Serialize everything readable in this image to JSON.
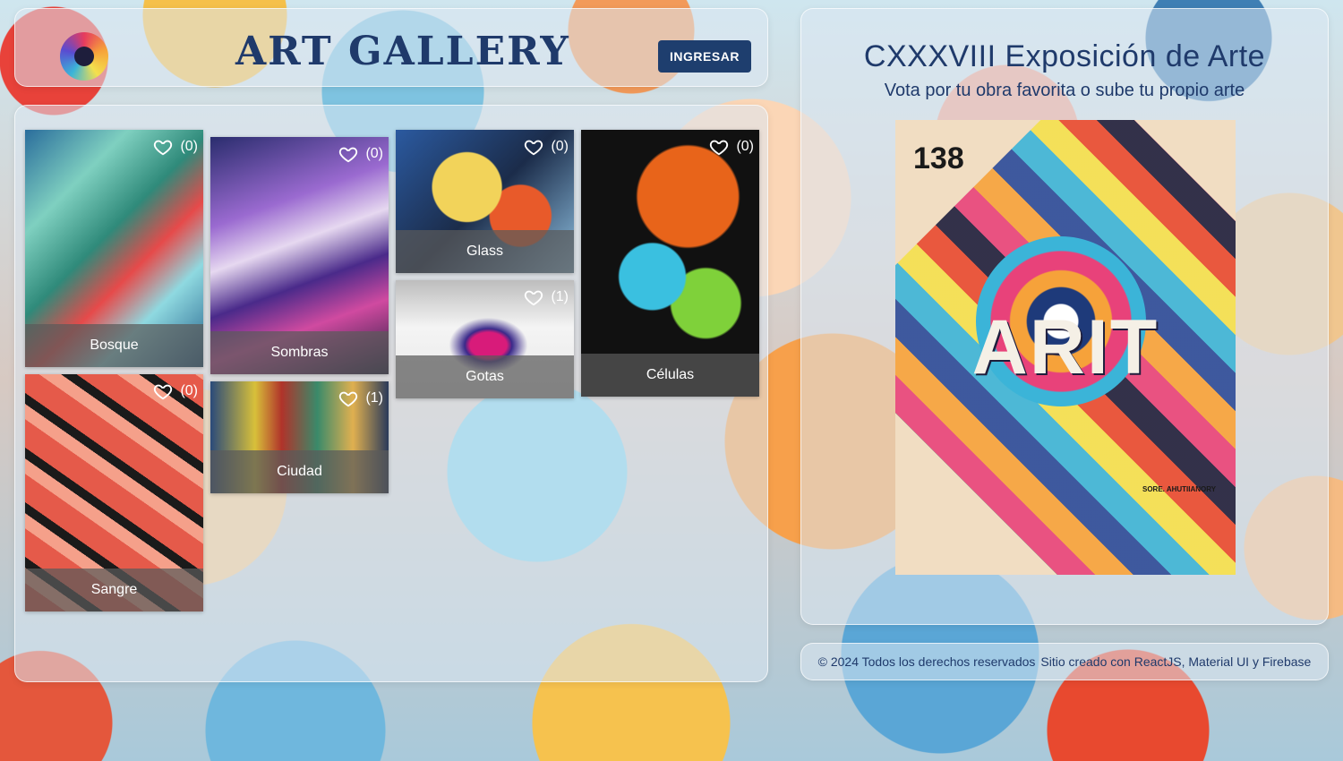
{
  "header": {
    "title": "ART GALLERY",
    "login_label": "INGRESAR"
  },
  "gallery": {
    "items": [
      {
        "title": "Bosque",
        "likes": "(0)"
      },
      {
        "title": "Sombras",
        "likes": "(0)"
      },
      {
        "title": "Glass",
        "likes": "(0)"
      },
      {
        "title": "Células",
        "likes": "(0)"
      },
      {
        "title": "Gotas",
        "likes": "(1)"
      },
      {
        "title": "Sangre",
        "likes": "(0)"
      },
      {
        "title": "Ciudad",
        "likes": "(1)"
      }
    ]
  },
  "info": {
    "title": "CXXXVIII Exposición de Arte",
    "subtitle": "Vota por tu obra favorita o sube tu propio arte",
    "poster": {
      "number": "138",
      "word": "ARIT",
      "footer_text": "SORE. AHUTIIANORY"
    }
  },
  "footer": {
    "copyright": "© 2024 Todos los derechos reservados",
    "credits": "Sitio creado con ReactJS, Material UI y Firebase"
  },
  "colors": {
    "primary": "#1f3a6b",
    "button": "#1e3e6e"
  },
  "icons": {
    "favorite": "heart-outline-icon",
    "logo": "colorful-swirl-logo"
  }
}
